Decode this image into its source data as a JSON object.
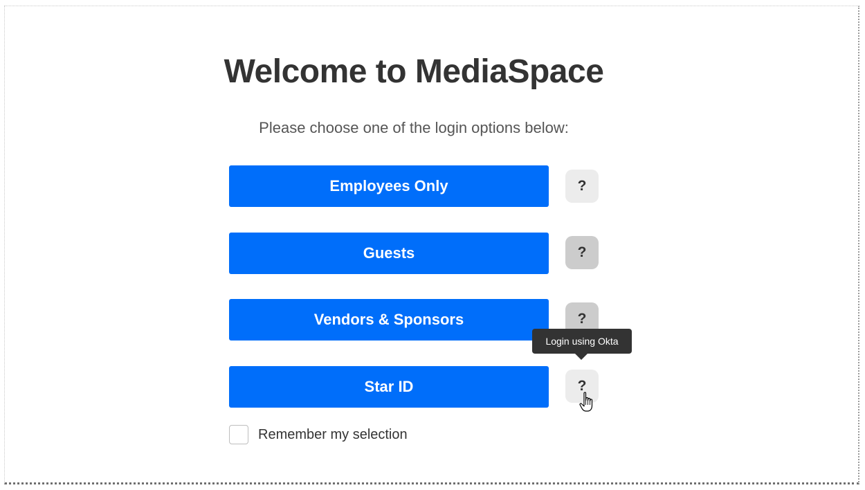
{
  "header": {
    "title": "Welcome to MediaSpace",
    "subtitle": "Please choose one of the login options below:"
  },
  "login_options": [
    {
      "label": "Employees Only",
      "help": "?"
    },
    {
      "label": "Guests",
      "help": "?"
    },
    {
      "label": "Vendors & Sponsors",
      "help": "?"
    },
    {
      "label": "Star ID",
      "help": "?"
    }
  ],
  "tooltip": {
    "text": "Login using Okta"
  },
  "remember": {
    "label": "Remember my selection",
    "checked": false
  },
  "colors": {
    "primary": "#006efa",
    "help_bg": "#ececec",
    "help_hover_bg": "#cccccc",
    "tooltip_bg": "#333333"
  },
  "icons": {
    "cursor": "hand-pointer-icon"
  }
}
